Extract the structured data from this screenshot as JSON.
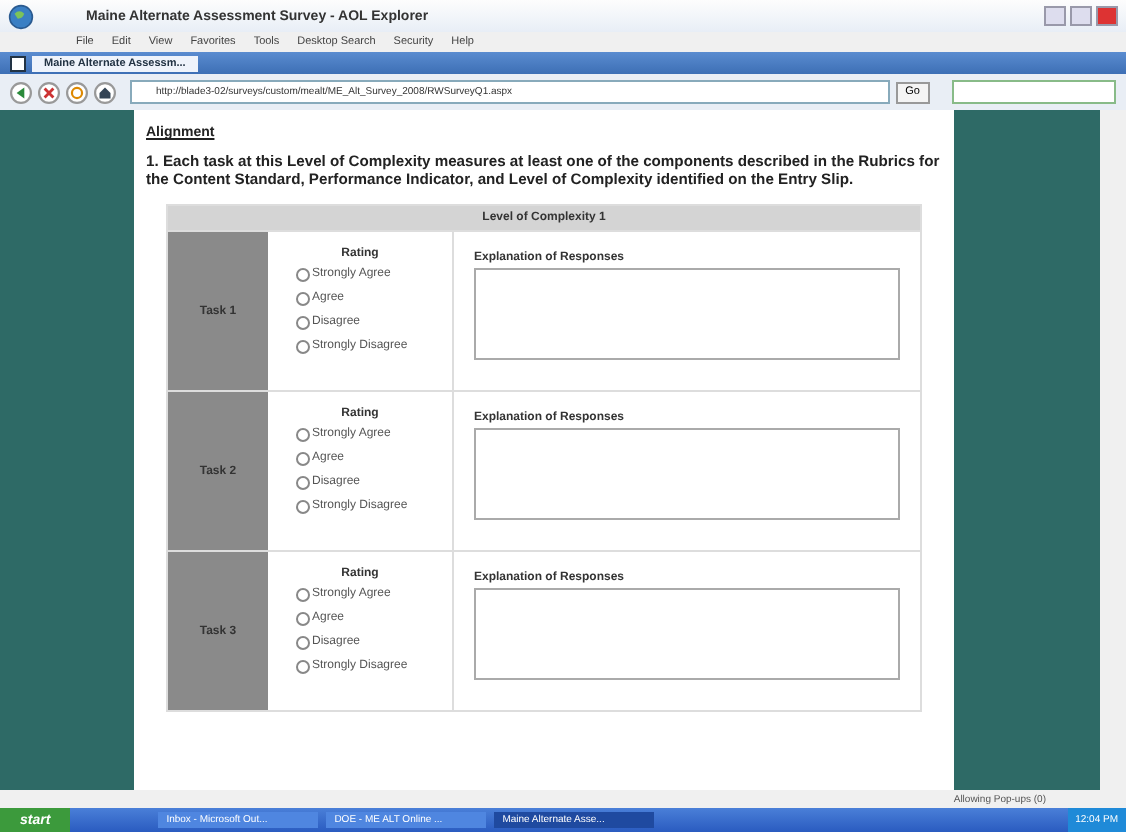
{
  "window": {
    "title": "Maine Alternate Assessment Survey - AOL Explorer"
  },
  "menu": [
    "File",
    "Edit",
    "View",
    "Favorites",
    "Tools",
    "Desktop Search",
    "Security",
    "Help"
  ],
  "tabs": [
    {
      "label": "Maine Alternate Assessm...",
      "selected": true
    }
  ],
  "address_bar": {
    "url": "http://blade3-02/surveys/custom/mealt/ME_Alt_Survey_2008/RWSurveyQ1.aspx",
    "go_label": "Go"
  },
  "page": {
    "section_title": "Alignment",
    "question": "1. Each task at this Level of Complexity measures at least one of the components described in the Rubrics for the Content Standard, Performance Indicator, and Level of Complexity identified on the Entry Slip.",
    "table": {
      "header": "Level of Complexity 1",
      "rows": [
        {
          "task": "Task 1",
          "rating_label": "Rating",
          "options": [
            {
              "label": "Strongly Agree",
              "selected": false
            },
            {
              "label": "Agree",
              "selected": false
            },
            {
              "label": "Disagree",
              "selected": false
            },
            {
              "label": "Strongly Disagree",
              "selected": false
            }
          ],
          "explanation_label": "Explanation of Responses"
        },
        {
          "task": "Task 2",
          "rating_label": "Rating",
          "options": [
            {
              "label": "Strongly Agree",
              "selected": false
            },
            {
              "label": "Agree",
              "selected": false
            },
            {
              "label": "Disagree",
              "selected": false
            },
            {
              "label": "Strongly Disagree",
              "selected": false
            }
          ],
          "explanation_label": "Explanation of Responses"
        },
        {
          "task": "Task 3",
          "rating_label": "Rating",
          "options": [
            {
              "label": "Strongly Agree",
              "selected": false
            },
            {
              "label": "Agree",
              "selected": false
            },
            {
              "label": "Disagree",
              "selected": false
            },
            {
              "label": "Strongly Disagree",
              "selected": false
            }
          ],
          "explanation_label": "Explanation of Responses"
        }
      ]
    }
  },
  "status_bar": {
    "popup_text": "Allowing Pop-ups (0)"
  },
  "taskbar": {
    "start_label": "start",
    "items": [
      {
        "label": "Inbox - Microsoft Out...",
        "selected": false
      },
      {
        "label": "DOE - ME ALT Online ...",
        "selected": false
      },
      {
        "label": "Maine Alternate Asse...",
        "selected": true
      }
    ],
    "clock": "12:04 PM"
  }
}
